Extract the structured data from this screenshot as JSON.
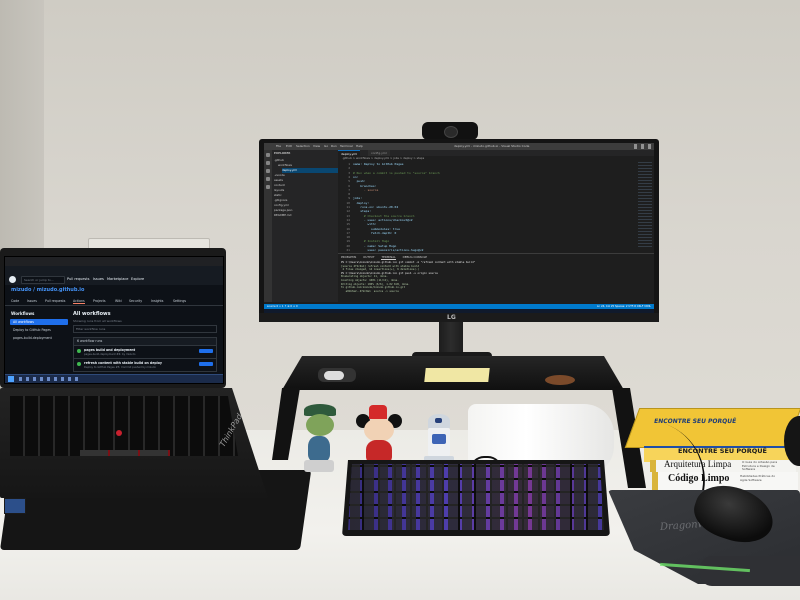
{
  "laptop": {
    "brand": "ThinkPad",
    "browser": {
      "github": {
        "search_placeholder": "Search or jump to...",
        "nav": [
          "Pull requests",
          "Issues",
          "Marketplace",
          "Explore"
        ],
        "repo_path": "mizudo / mizudo.github.io",
        "tabs": [
          "Code",
          "Issues",
          "Pull requests",
          "Actions",
          "Projects",
          "Wiki",
          "Security",
          "Insights",
          "Settings"
        ],
        "sidebar_title": "Workflows",
        "sidebar_items": [
          "All workflows",
          "Deploy to GitHub Pages",
          "pages-build-deployment"
        ],
        "main_title": "All workflows",
        "main_subtitle": "Showing runs from all workflows",
        "filter_placeholder": "Filter workflow runs",
        "runs_header": "6 workflow runs",
        "runs": [
          {
            "title": "pages build and deployment",
            "meta": "pages-build-deployment #6: by mizudo"
          },
          {
            "title": "refresh content with stable build on deploy",
            "meta": "Deploy to GitHub Pages #5: Commit pushed by mizudo"
          }
        ]
      }
    }
  },
  "monitor": {
    "brand": "LG",
    "vscode": {
      "menu": [
        "File",
        "Edit",
        "Selection",
        "View",
        "Go",
        "Run",
        "Terminal",
        "Help"
      ],
      "window_title": "deploy.yml - mizudo.github.io - Visual Studio Code",
      "explorer_header": "EXPLORER",
      "tree": [
        ".github",
        "workflows",
        "deploy.yml",
        ".vscode",
        "assets",
        "content",
        "layouts",
        "static",
        ".gitignore",
        "config.yml",
        "package.json",
        "README.md"
      ],
      "selected_tree_item": "deploy.yml",
      "tabs": [
        "deploy.yml",
        "config.yml"
      ],
      "breadcrumb": ".github > workflows > deploy.yml > jobs > deploy > steps",
      "code_lines": [
        "name: Deploy to GitHub Pages",
        "",
        "# Run when a commit is pushed to \"source\" branch",
        "on:",
        "  push:",
        "    branches:",
        "      - source",
        "",
        "jobs:",
        "  deploy:",
        "    runs-on: ubuntu-20.04",
        "    steps:",
        "      # Checkout the source branch",
        "      - uses: actions/checkout@v2",
        "        with:",
        "          submodules: true",
        "          fetch-depth: 0",
        "",
        "      # Install Hugo",
        "      - name: Setup Hugo",
        "        uses: peaceiris/actions-hugo@v2",
        "        with:",
        "          hugo-version: 'latest'",
        "          extended: true"
      ],
      "panel_tabs": [
        "PROBLEMS",
        "OUTPUT",
        "TERMINAL",
        "DEBUG CONSOLE"
      ],
      "terminal_lines": [
        "PS C:\\Users\\mizudo\\mizudo.github.io> git commit -m \"refresh content with stable build\"",
        "[source 4f2c9a1] refresh content with stable build",
        " 2 files changed, 14 insertions(+), 6 deletions(-)",
        "PS C:\\Users\\mizudo\\mizudo.github.io> git push -u origin source",
        "Enumerating objects: 11, done.",
        "Counting objects: 100% (11/11), done.",
        "Writing objects: 100% (6/6), 1.02 KiB, done.",
        "To github.com:mizudo/mizudo.github.io.git",
        "   a81b3e2..4f2c9a1  source -> source"
      ],
      "status_left": "source  0 ↓ 1 ↑  ⊗ 0 ⚠ 0",
      "status_right": "Ln 24, Col 25  Spaces: 2  UTF-8  CRLF  YAML"
    }
  },
  "books": [
    {
      "title": "ENCONTRE SEU PORQUÊ",
      "subtitle": ""
    },
    {
      "title": "ENCONTRE SEU PORQUÊ",
      "subtitle": ""
    },
    {
      "title": "Arquitetura Limpa",
      "subtitle": "O Guia do Artesão para Estrutura e Design de Software"
    },
    {
      "title": "Código Limpo",
      "subtitle": "Habilidades Práticas do Agile Software"
    }
  ],
  "mousepad": {
    "brand": "Dragonwar"
  }
}
